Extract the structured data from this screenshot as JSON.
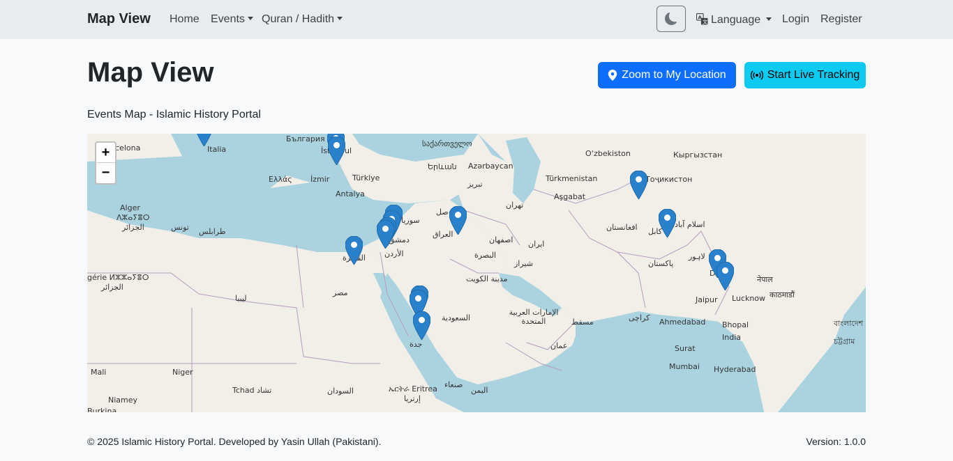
{
  "navbar": {
    "brand": "Map View",
    "links": {
      "home": "Home",
      "events": "Events",
      "quran_hadith": "Quran / Hadith",
      "language": "Language",
      "login": "Login",
      "register": "Register"
    }
  },
  "page": {
    "title": "Map View",
    "zoom_button": "Zoom to My Location",
    "tracking_button": "Start Live Tracking",
    "subtitle": "Events Map - Islamic History Portal"
  },
  "map": {
    "zoom_in": "+",
    "zoom_out": "−",
    "marker_color": "#2a81cb",
    "labels": {
      "barcelona": "celona",
      "italia": "Italia",
      "bulgaria": "България",
      "istanbul": "İstanbul",
      "georgia": "საქართველო",
      "uzbekistan": "O‘zbekiston",
      "kyrgyzstan": "Кыргызстан",
      "armenia": "Երևան",
      "azerbaijan": "Azərbaycan",
      "turkiye": "Türkiye",
      "izmir": "İzmir",
      "antalya": "Antalya",
      "ellas": "Ελλάς",
      "tabriz": "تبریز",
      "turkmenistan": "Türkmenistan",
      "tajikistan": "Тоҷикистон",
      "ashgabat": "Aşgabat",
      "alger": "Alger",
      "alger_tif": "ⴷⵣⴰⵢⴻⵔ",
      "aljazair": "الجزائر",
      "tunis": "تونس",
      "tarabulus": "طرابلس",
      "syria": "سوريا",
      "mosul": "صل",
      "tehran": "تهران",
      "afghanistan": "افغانستان",
      "islamabad": "اسلام آباد",
      "kabul": "کابل",
      "dimashq": "دمشق",
      "iraq": "العراق",
      "isfahan": "اصفهان",
      "iran": "ایران",
      "cairo": "القاهرة",
      "jordan": "الأردن",
      "basra": "البصرة",
      "shiraz": "شیراز",
      "pakistan": "پاکستان",
      "lahore": "لاہور",
      "delhi": "D",
      "nepal": "नेपाल",
      "algerie": "gérie ⵍⵣⵣⴰⵢⴻⵔ",
      "aljazair2": "الجزائر",
      "libya": "ليبيا",
      "misr": "مصر",
      "kuwait": "مدينة الكويت",
      "jaipur": "Jaipur",
      "lucknow": "Lucknow",
      "kathmandu": "काठमाडौं",
      "saudi": "السعودية",
      "uae": "الإمارات العربية المتحدة",
      "muscat": "مسقط",
      "karachi": "کراچی",
      "ahmedabad": "Ahmedabad",
      "bhopal": "Bhopal",
      "india": "India",
      "bangladesh": "বাংলাদেশ",
      "chattogram": "চট্টগ্রাম",
      "jeddah": "جدة",
      "surat": "Surat",
      "oman": "عمان",
      "mumbai": "Mumbai",
      "hyderabad": "Hyderabad",
      "mali": "Mali",
      "niger": "Niger",
      "eritrea": "ኤርትራ Eritrea",
      "eritrea_ar": "إرتريا",
      "sanaa": "صنعاء",
      "tchad": "Tchad تشاد",
      "sudan": "السودان",
      "yemen": "اليمن",
      "niamey": "Niamey",
      "burkina": "Burkina"
    }
  },
  "footer": {
    "copyright": "© 2025 Islamic History Portal. Developed by Yasin Ullah (Pakistani).",
    "version": "Version: 1.0.0"
  }
}
